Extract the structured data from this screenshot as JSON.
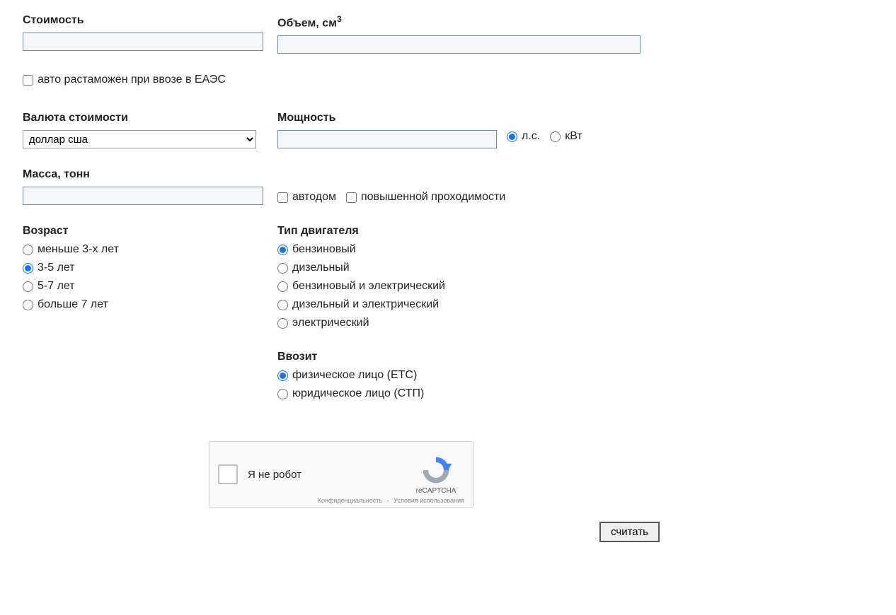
{
  "cost": {
    "label": "Стоимость",
    "value": ""
  },
  "volume": {
    "label_prefix": "Объем, см",
    "label_sup": "3",
    "value": ""
  },
  "customs_checkbox": {
    "label": "авто растаможен при ввозе в ЕАЭС",
    "checked": false
  },
  "currency": {
    "label": "Валюта стоимости",
    "selected": "доллар сша",
    "options": [
      "доллар сша"
    ]
  },
  "power": {
    "label": "Мощность",
    "value": "",
    "unit_selected": "hp",
    "unit_hp": "л.с.",
    "unit_kw": "кВт"
  },
  "mass": {
    "label": "Масса, тонн",
    "value": "",
    "motorhome": {
      "label": "автодом",
      "checked": false
    },
    "offroad": {
      "label": "повышенной проходимости",
      "checked": false
    }
  },
  "age": {
    "label": "Возраст",
    "selected": "3-5",
    "options": [
      {
        "id": "lt3",
        "label": "меньше 3-х лет"
      },
      {
        "id": "3-5",
        "label": "3-5 лет"
      },
      {
        "id": "5-7",
        "label": "5-7 лет"
      },
      {
        "id": "gt7",
        "label": "больше 7 лет"
      }
    ]
  },
  "engine": {
    "label": "Тип двигателя",
    "selected": "petrol",
    "options": [
      {
        "id": "petrol",
        "label": "бензиновый"
      },
      {
        "id": "diesel",
        "label": "дизельный"
      },
      {
        "id": "petrol-electric",
        "label": "бензиновый и электрический"
      },
      {
        "id": "diesel-electric",
        "label": "дизельный и электрический"
      },
      {
        "id": "electric",
        "label": "электрический"
      }
    ]
  },
  "importer": {
    "label": "Ввозит",
    "selected": "individual",
    "options": [
      {
        "id": "individual",
        "label": "физическое лицо (ЕТС)"
      },
      {
        "id": "legal",
        "label": "юридическое лицо (СТП)"
      }
    ]
  },
  "recaptcha": {
    "text": "Я не робот",
    "brand": "reCAPTCHA",
    "privacy": "Конфиденциальность",
    "terms": "Условия использования",
    "sep": "-"
  },
  "submit": {
    "label": "считать"
  }
}
